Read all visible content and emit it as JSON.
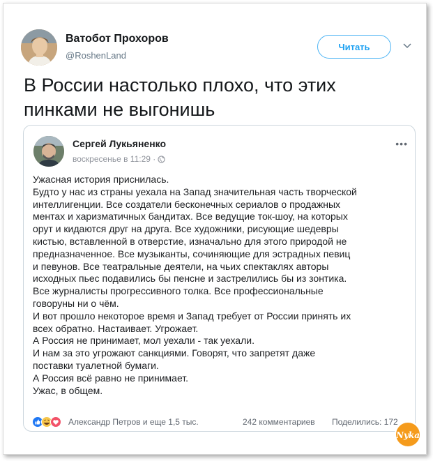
{
  "tweet": {
    "author_name": "Ватобот Прохоров",
    "author_handle": "@RoshenLand",
    "follow_label": "Читать",
    "text_line1": "В России настолько плохо, что этих",
    "text_line2": "пинками не выгонишь"
  },
  "embedded_post": {
    "author_name": "Сергей Лукьяненко",
    "meta_time": "воскресенье в 11:29 ·",
    "visibility_icon": "globe-icon",
    "more_icon": "more-dots-icon",
    "lines": [
      "Ужасная история приснилась.",
      "Будто у нас из страны уехала на Запад значительная часть творческой",
      "интеллигенции. Все создатели бесконечных сериалов о продажных",
      "ментах и харизматичных бандитах. Все ведущие ток-шоу, на которых",
      "орут и кидаются друг на друга. Все художники, рисующие шедевры",
      "кистью, вставленной в отверстие, изначально для этого природой не",
      "предназначенное. Все музыканты, сочиняющие для эстрадных певиц",
      "и певунов. Все театральные деятели, на чьих спектаклях авторы",
      "исходных пьес подавились бы пенсне и застрелились бы из зонтика.",
      "Все журналисты прогрессивного толка. Все профессиональные",
      "говоруны ни о чём.",
      "И вот прошло некоторое время и Запад требует от России принять их",
      "всех обратно. Настаивает. Угрожает.",
      "А Россия не принимает, мол уехали - так уехали.",
      "И нам за это угрожают санкциями. Говорят, что запретят даже",
      "поставки туалетной бумаги.",
      "А Россия всё равно не принимает.",
      "Ужас, в общем."
    ],
    "reactions_text": "Александр Петров и еще 1,5 тыс.",
    "comments_text": "242 комментариев",
    "shares_text": "Поделились: 172"
  },
  "watermark_text": "Nyka",
  "colors": {
    "twitter_blue": "#1da1f2",
    "like_blue": "#2078f4",
    "haha_yellow": "#f7c64b",
    "love_red": "#f25268"
  }
}
